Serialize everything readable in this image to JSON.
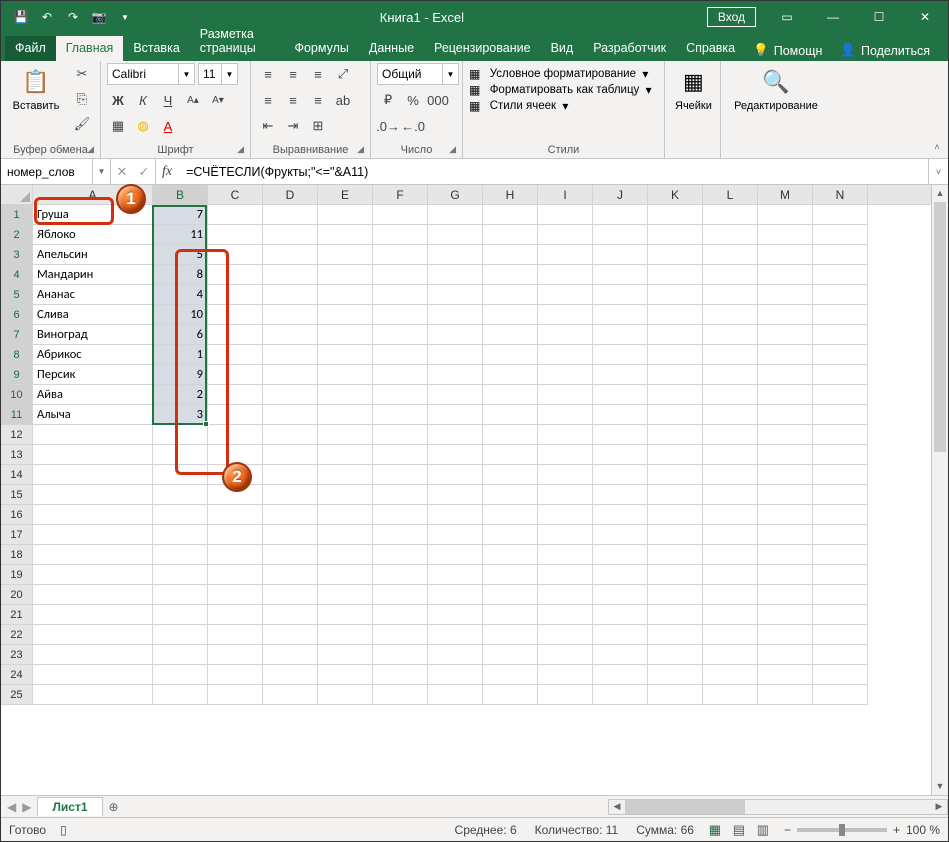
{
  "title": "Книга1  -  Excel",
  "signin": "Вход",
  "tabs": {
    "file": "Файл",
    "home": "Главная",
    "insert": "Вставка",
    "layout": "Разметка страницы",
    "formulas": "Формулы",
    "data": "Данные",
    "review": "Рецензирование",
    "view": "Вид",
    "developer": "Разработчик",
    "help": "Справка"
  },
  "tell_me": "Помощн",
  "share": "Поделиться",
  "ribbon": {
    "clipboard": {
      "paste": "Вставить",
      "label": "Буфер обмена"
    },
    "font": {
      "name": "Calibri",
      "size": "11",
      "label": "Шрифт"
    },
    "align": {
      "label": "Выравнивание"
    },
    "number": {
      "format": "Общий",
      "label": "Число"
    },
    "styles": {
      "cond": "Условное форматирование",
      "table": "Форматировать как таблицу",
      "cell": "Стили ячеек",
      "label": "Стили"
    },
    "cells": {
      "label": "Ячейки"
    },
    "editing": {
      "label": "Редактирование"
    }
  },
  "namebox": "номер_слов",
  "formula": "=СЧЁТЕСЛИ(Фрукты;\"<=\"&A11)",
  "columns": [
    "A",
    "B",
    "C",
    "D",
    "E",
    "F",
    "G",
    "H",
    "I",
    "J",
    "K",
    "L",
    "M",
    "N"
  ],
  "rows": [
    {
      "n": 1,
      "a": "Груша",
      "b": 7
    },
    {
      "n": 2,
      "a": "Яблоко",
      "b": 11
    },
    {
      "n": 3,
      "a": "Апельсин",
      "b": 5
    },
    {
      "n": 4,
      "a": "Мандарин",
      "b": 8
    },
    {
      "n": 5,
      "a": "Ананас",
      "b": 4
    },
    {
      "n": 6,
      "a": "Слива",
      "b": 10
    },
    {
      "n": 7,
      "a": "Виноград",
      "b": 6
    },
    {
      "n": 8,
      "a": "Абрикос",
      "b": 1
    },
    {
      "n": 9,
      "a": "Персик",
      "b": 9
    },
    {
      "n": 10,
      "a": "Айва",
      "b": 2
    },
    {
      "n": 11,
      "a": "Алыча",
      "b": 3
    }
  ],
  "empty_rows": [
    12,
    13,
    14,
    15,
    16,
    17,
    18,
    19,
    20,
    21,
    22,
    23,
    24,
    25
  ],
  "sheet": "Лист1",
  "status": {
    "ready": "Готово",
    "avg": "Среднее: 6",
    "count": "Количество: 11",
    "sum": "Сумма: 66",
    "zoom": "100 %"
  }
}
